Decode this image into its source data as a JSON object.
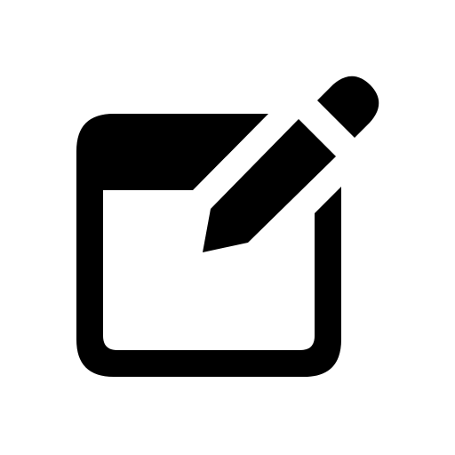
{
  "icon": {
    "name": "edit-icon",
    "parts": [
      "window-frame",
      "pencil"
    ],
    "color": "#000000",
    "background": "#ffffff"
  }
}
